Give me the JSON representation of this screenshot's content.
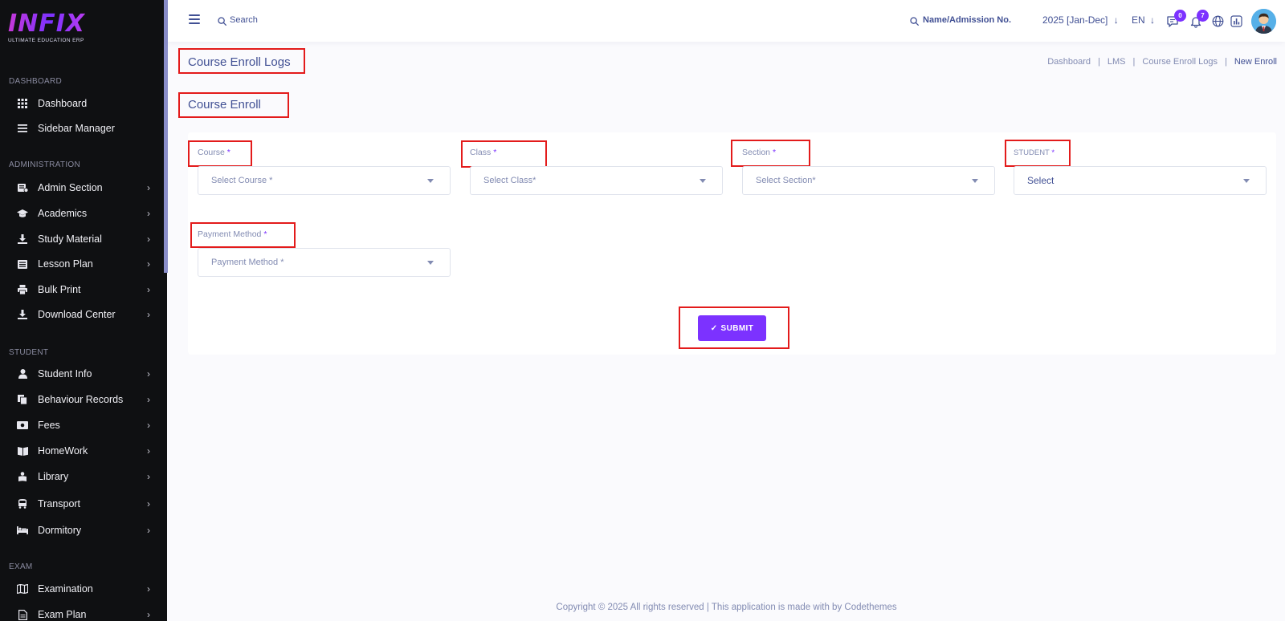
{
  "logo": {
    "word": "INFIX",
    "tagline": "ULTIMATE EDUCATION ERP"
  },
  "sidebar": {
    "sections": [
      {
        "heading": "DASHBOARD",
        "items": [
          {
            "label": "Dashboard",
            "icon": "grid-icon",
            "chevron": false
          },
          {
            "label": "Sidebar Manager",
            "icon": "bars-icon",
            "chevron": false
          }
        ]
      },
      {
        "heading": "ADMINISTRATION",
        "items": [
          {
            "label": "Admin Section",
            "icon": "admin-icon",
            "chevron": true
          },
          {
            "label": "Academics",
            "icon": "graduation-cap-icon",
            "chevron": true
          },
          {
            "label": "Study Material",
            "icon": "download-icon",
            "chevron": true
          },
          {
            "label": "Lesson Plan",
            "icon": "list-icon",
            "chevron": true
          },
          {
            "label": "Bulk Print",
            "icon": "printer-icon",
            "chevron": true
          },
          {
            "label": "Download Center",
            "icon": "download-icon",
            "chevron": true
          }
        ]
      },
      {
        "heading": "STUDENT",
        "items": [
          {
            "label": "Student Info",
            "icon": "user-icon",
            "chevron": true
          },
          {
            "label": "Behaviour Records",
            "icon": "files-icon",
            "chevron": true
          },
          {
            "label": "Fees",
            "icon": "money-icon",
            "chevron": true
          },
          {
            "label": "HomeWork",
            "icon": "book-icon",
            "chevron": true
          },
          {
            "label": "Library",
            "icon": "reader-icon",
            "chevron": true
          },
          {
            "label": "Transport",
            "icon": "bus-icon",
            "chevron": true
          },
          {
            "label": "Dormitory",
            "icon": "bed-icon",
            "chevron": true
          }
        ]
      },
      {
        "heading": "EXAM",
        "items": [
          {
            "label": "Examination",
            "icon": "map-icon",
            "chevron": true
          },
          {
            "label": "Exam Plan",
            "icon": "document-icon",
            "chevron": true
          }
        ]
      }
    ]
  },
  "header": {
    "search_label": "Search",
    "student_search_label": "Name/Admission No.",
    "academic_year": "2025 [Jan-Dec]",
    "language": "EN",
    "chat_badge": "0",
    "notification_badge": "7"
  },
  "page": {
    "title": "Course Enroll Logs",
    "breadcrumb": [
      "Dashboard",
      "LMS",
      "Course Enroll Logs",
      "New Enroll"
    ],
    "section_title": "Course Enroll"
  },
  "form": {
    "course": {
      "label": "Course",
      "required": "*",
      "placeholder": "Select Course *"
    },
    "class": {
      "label": "Class",
      "required": "*",
      "placeholder": "Select Class*"
    },
    "section": {
      "label": "Section",
      "required": "*",
      "placeholder": "Select Section*"
    },
    "student": {
      "label": "STUDENT",
      "required": "*",
      "placeholder": "Select"
    },
    "payment": {
      "label": "Payment Method",
      "required": "*",
      "placeholder": "Payment Method *"
    },
    "submit_label": "SUBMIT",
    "submit_check": "✓"
  },
  "footer": {
    "text": "Copyright © 2025 All rights reserved | This application is made with by Codethemes"
  },
  "colors": {
    "accent": "#7c32ff",
    "text": "#415094",
    "muted": "#828bb2",
    "highlight": "#e31b1b",
    "sidebar_bg": "#0f1012"
  }
}
